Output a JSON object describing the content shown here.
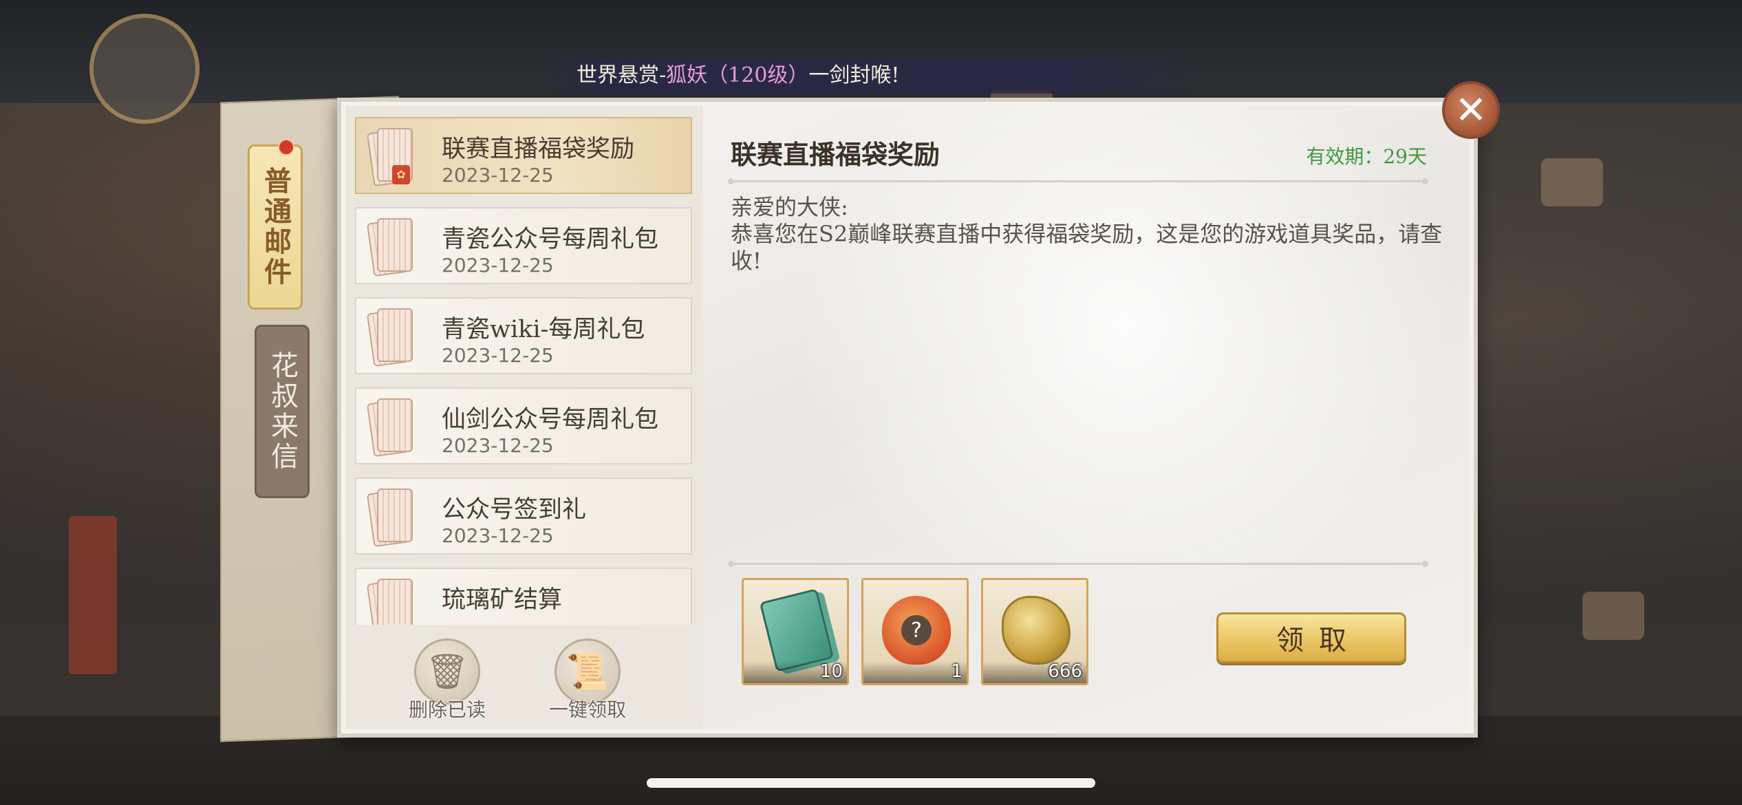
{
  "marquee": {
    "prefix": "世界悬赏-",
    "highlight": "狐妖（120级）",
    "suffix": "一剑封喉!"
  },
  "tabs": [
    {
      "label": "普通邮件",
      "active": true,
      "has_notification": true
    },
    {
      "label": "花叔来信",
      "active": false,
      "has_notification": false
    }
  ],
  "mail_list": [
    {
      "title": "联赛直播福袋奖励",
      "date": "2023-12-25",
      "selected": true
    },
    {
      "title": "青瓷公众号每周礼包",
      "date": "2023-12-25",
      "selected": false
    },
    {
      "title": "青瓷wiki-每周礼包",
      "date": "2023-12-25",
      "selected": false
    },
    {
      "title": "仙剑公众号每周礼包",
      "date": "2023-12-25",
      "selected": false
    },
    {
      "title": "公众号签到礼",
      "date": "2023-12-25",
      "selected": false
    },
    {
      "title": "琉璃矿结算",
      "date": "",
      "selected": false
    }
  ],
  "list_actions": {
    "delete_read": "删除已读",
    "collect_all": "一键领取"
  },
  "detail": {
    "title": "联赛直播福袋奖励",
    "expiry": "有效期：29天",
    "greeting": "亲爱的大侠:",
    "body": "恭喜您在S2巅峰联赛直播中获得福袋奖励，这是您的游戏道具奖品，请查收!",
    "rewards": [
      {
        "icon": "ticket-icon",
        "quantity": "10"
      },
      {
        "icon": "mystery-bag-icon",
        "quantity": "1"
      },
      {
        "icon": "gold-dragon-icon",
        "quantity": "666"
      }
    ],
    "claim_label": "领取"
  },
  "close_glyph": "✕",
  "colors": {
    "expiry_green": "#3f9a3e",
    "marquee_highlight": "#e79bd9",
    "claim_gold": "#ecc968"
  }
}
